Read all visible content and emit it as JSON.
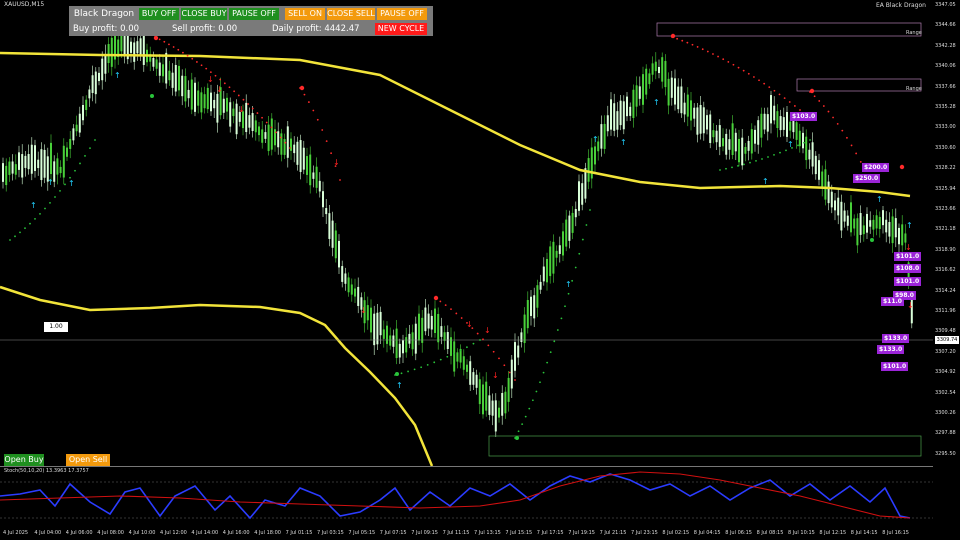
{
  "chart": {
    "symbol_title": "XAUUSD,M15",
    "ea_label": "EA Black Dragon",
    "level_box": "1.00",
    "current_price": "3309.74",
    "price_ticks": [
      "3347.05",
      "3344.66",
      "3342.28",
      "3340.06",
      "3337.66",
      "3335.28",
      "3333.00",
      "3330.60",
      "3328.22",
      "3325.94",
      "3323.66",
      "3321.18",
      "3318.90",
      "3316.62",
      "3314.24",
      "3311.96",
      "3309.48",
      "3307.20",
      "3304.92",
      "3302.54",
      "3300.26",
      "3297.88",
      "3295.50"
    ],
    "time_ticks": [
      "4 Jul 2025",
      "4 Jul 04:00",
      "4 Jul 06:00",
      "4 Jul 08:00",
      "4 Jul 10:00",
      "4 Jul 12:00",
      "4 Jul 14:00",
      "4 Jul 16:00",
      "4 Jul 18:00",
      "7 Jul 01:15",
      "7 Jul 03:15",
      "7 Jul 05:15",
      "7 Jul 07:15",
      "7 Jul 09:15",
      "7 Jul 11:15",
      "7 Jul 13:15",
      "7 Jul 15:15",
      "7 Jul 17:15",
      "7 Jul 19:15",
      "7 Jul 21:15",
      "7 Jul 23:15",
      "8 Jul 02:15",
      "8 Jul 04:15",
      "8 Jul 06:15",
      "8 Jul 08:15",
      "8 Jul 10:15",
      "8 Jul 12:15",
      "8 Jul 14:15",
      "8 Jul 16:15"
    ],
    "range_labels": [
      "Range",
      "Range"
    ]
  },
  "panel": {
    "name": "Black Dragon",
    "buy_off": "BUY OFF",
    "close_buy": "CLOSE BUY",
    "pause_off_1": "PAUSE OFF",
    "sell_on": "SELL ON",
    "close_sell": "CLOSE SELL",
    "pause_off_2": "PAUSE OFF",
    "buy_profit": "Buy profit: 0.00",
    "sell_profit": "Sell profit: 0.00",
    "daily_profit": "Daily profit: 4442.47",
    "new_cycle": "NEW CYCLE"
  },
  "profit_tags": [
    "$103.0",
    "$200.0",
    "$250.0",
    "$101.0",
    "$108.0",
    "$101.0",
    "$98.0",
    "$11.0",
    "$133.0",
    "$133.0",
    "$101.0"
  ],
  "buttons": {
    "open_buy": "Open Buy",
    "open_sell": "Open Sell"
  },
  "stoch": {
    "label": "Stoch(50,10,20) 13.3963 17.3757",
    "levels": [
      "80",
      "20"
    ]
  },
  "colors": {
    "bull": "#49d13a",
    "bear": "#d9ffd9",
    "band": "#f2e43a",
    "psar_bear": "#ff2a2a",
    "psar_bull": "#29c43a",
    "arrow_up": "#21d0ff",
    "arrow_down": "#ff2222",
    "button_green": "#1f8f1f",
    "button_orange": "#f39a0d",
    "button_red": "#ff1a1a",
    "tag_purple": "#9b24d8",
    "stoch_main": "#2b3cff",
    "stoch_signal": "#d01010"
  }
}
